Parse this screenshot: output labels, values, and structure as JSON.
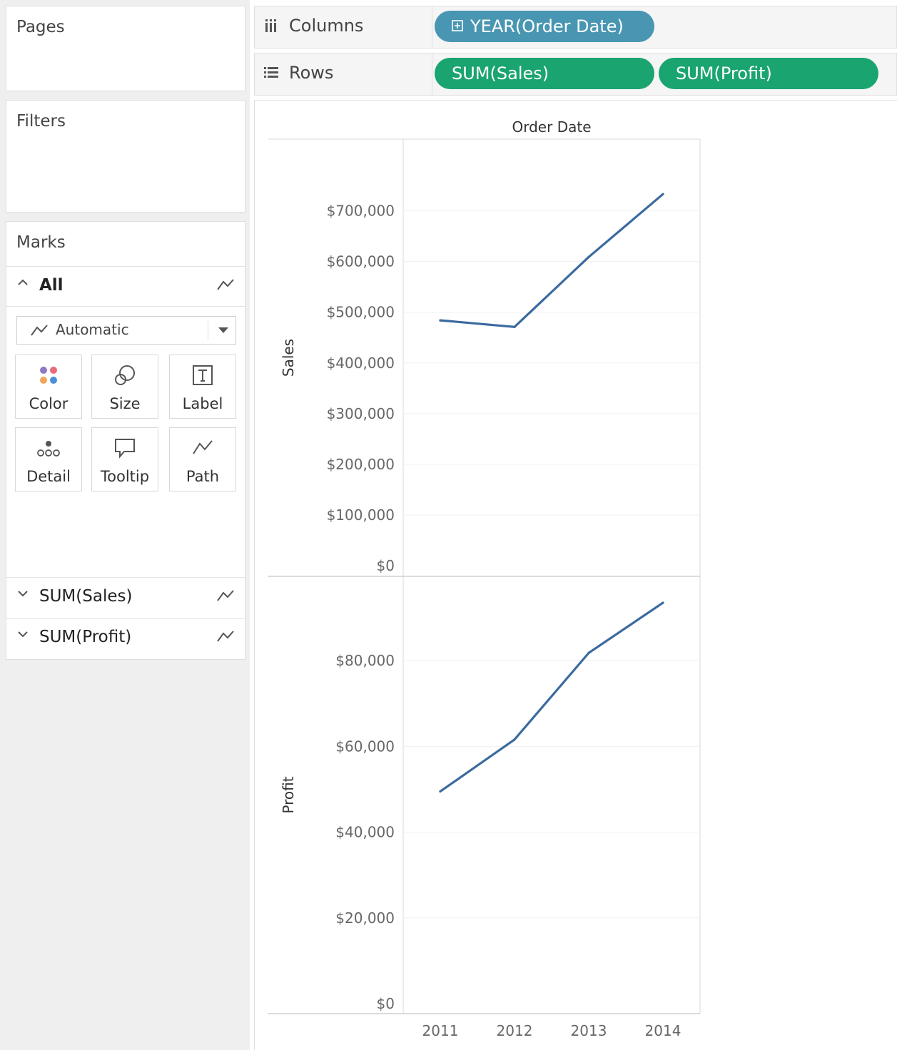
{
  "left_panel": {
    "pages_title": "Pages",
    "filters_title": "Filters",
    "marks": {
      "title": "Marks",
      "all_label": "All",
      "mark_type": "Automatic",
      "buttons": [
        {
          "label": "Color",
          "icon": "color-icon"
        },
        {
          "label": "Size",
          "icon": "size-icon"
        },
        {
          "label": "Label",
          "icon": "label-icon"
        },
        {
          "label": "Detail",
          "icon": "detail-icon"
        },
        {
          "label": "Tooltip",
          "icon": "tooltip-icon"
        },
        {
          "label": "Path",
          "icon": "path-icon"
        }
      ],
      "measure_cards": [
        {
          "label": "SUM(Sales)"
        },
        {
          "label": "SUM(Profit)"
        }
      ]
    }
  },
  "shelves": {
    "columns": {
      "label": "Columns",
      "pills": [
        {
          "label": "YEAR(Order Date)",
          "color": "#4996b2"
        }
      ]
    },
    "rows": {
      "label": "Rows",
      "pills": [
        {
          "label": "SUM(Sales)",
          "color": "#1aa46f"
        },
        {
          "label": "SUM(Profit)",
          "color": "#1aa46f"
        }
      ]
    }
  },
  "chart_data": {
    "type": "line",
    "title": "Order Date",
    "categories": [
      "2011",
      "2012",
      "2013",
      "2014"
    ],
    "line_color": "#3b6a9e",
    "grid": true,
    "panes": [
      {
        "ylabel": "Sales",
        "values": [
          484000,
          471000,
          609000,
          733000
        ],
        "ylim": [
          0,
          760000
        ],
        "ticks": [
          0,
          100000,
          200000,
          300000,
          400000,
          500000,
          600000,
          700000
        ],
        "tick_labels": [
          "$0",
          "$100,000",
          "$200,000",
          "$300,000",
          "$400,000",
          "$500,000",
          "$600,000",
          "$700,000"
        ]
      },
      {
        "ylabel": "Profit",
        "values": [
          49500,
          61600,
          81800,
          93500
        ],
        "ylim": [
          0,
          97000
        ],
        "ticks": [
          0,
          20000,
          40000,
          60000,
          80000
        ],
        "tick_labels": [
          "$0",
          "$20,000",
          "$40,000",
          "$60,000",
          "$80,000"
        ]
      }
    ]
  }
}
